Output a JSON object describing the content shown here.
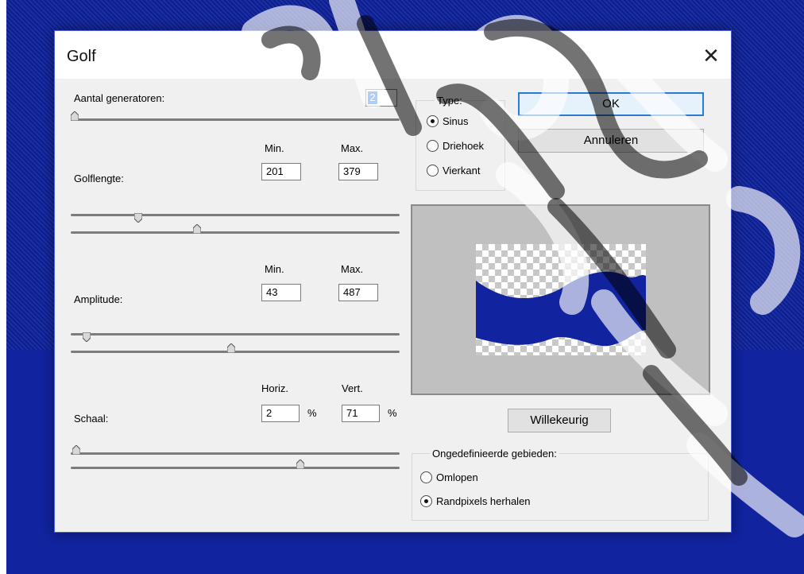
{
  "dialog": {
    "title": "Golf",
    "close_icon": "close-icon"
  },
  "generators": {
    "label": "Aantal generatoren:",
    "value": "2",
    "slider_level": 0.0
  },
  "wavelength": {
    "label": "Golflengte:",
    "min_label": "Min.",
    "max_label": "Max.",
    "min": "201",
    "max": "379",
    "min_level": 0.2,
    "max_level": 0.38
  },
  "amplitude": {
    "label": "Amplitude:",
    "min_label": "Min.",
    "max_label": "Max.",
    "min": "43",
    "max": "487",
    "min_level": 0.043,
    "max_level": 0.487
  },
  "scale": {
    "label": "Schaal:",
    "horiz_label": "Horiz.",
    "vert_label": "Vert.",
    "horiz": "2",
    "vert": "71",
    "unit": "%",
    "horiz_level": 0.0,
    "vert_level": 0.7
  },
  "type": {
    "legend": "Type:",
    "options": [
      "Sinus",
      "Driehoek",
      "Vierkant"
    ],
    "selected": "Sinus"
  },
  "buttons": {
    "ok": "OK",
    "cancel": "Annuleren",
    "randomize": "Willekeurig"
  },
  "undefined_areas": {
    "legend": "Ongedefinieerde gebieden:",
    "options": [
      "Omlopen",
      "Randpixels herhalen"
    ],
    "selected": "Randpixels herhalen"
  },
  "colors": {
    "accent": "#2a7ad8",
    "wave_fill": "#11239e",
    "background": "#11239e"
  }
}
